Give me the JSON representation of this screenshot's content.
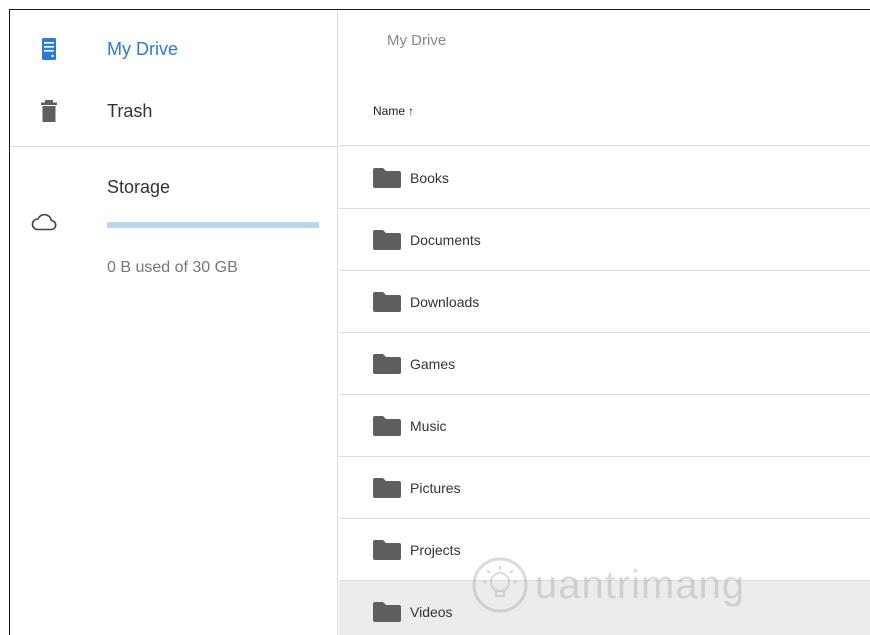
{
  "sidebar": {
    "nav": [
      {
        "label": "My Drive",
        "icon": "drive-icon",
        "active": true
      },
      {
        "label": "Trash",
        "icon": "trash-icon",
        "active": false
      }
    ],
    "storage": {
      "title": "Storage",
      "icon": "cloud-icon",
      "used_text": "0 B used of 30 GB",
      "used_fraction": 0
    }
  },
  "main": {
    "breadcrumb": "My Drive",
    "column": {
      "name_label": "Name",
      "sort_arrow": "↑"
    },
    "files": [
      {
        "name": "Books",
        "icon": "folder-icon"
      },
      {
        "name": "Documents",
        "icon": "folder-icon"
      },
      {
        "name": "Downloads",
        "icon": "folder-icon"
      },
      {
        "name": "Games",
        "icon": "folder-icon"
      },
      {
        "name": "Music",
        "icon": "folder-icon"
      },
      {
        "name": "Pictures",
        "icon": "folder-icon"
      },
      {
        "name": "Projects",
        "icon": "folder-icon"
      },
      {
        "name": "Videos",
        "icon": "folder-icon",
        "selected": true
      }
    ]
  },
  "watermark": {
    "text": "uantrimang"
  },
  "colors": {
    "accent": "#2b7bd5",
    "storage_track": "#bcd6f0",
    "folder": "#5f5f5f",
    "divider": "#dcdcdc",
    "selected_row": "#ececec"
  }
}
